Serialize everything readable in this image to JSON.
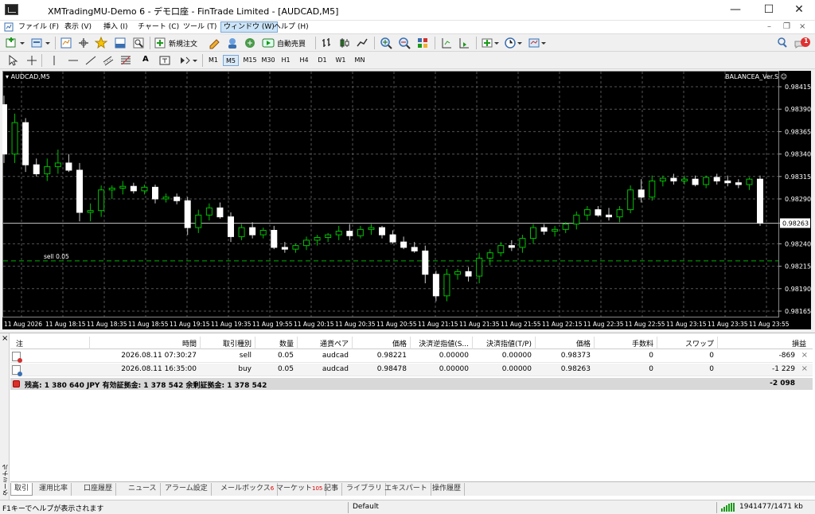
{
  "window": {
    "title": "XMTradingMU-Demo 6 - デモ口座 - FinTrade Limited - [AUDCAD,M5]"
  },
  "menu": [
    "ファイル (F)",
    "表示 (V)",
    "挿入 (I)",
    "チャート (C)",
    "ツール (T)",
    "ウィンドウ (W)",
    "ヘルプ (H)"
  ],
  "toolbar": {
    "new_order": "新規注文",
    "auto_trading": "自動売買"
  },
  "timeframes": [
    "M1",
    "M5",
    "M15",
    "M30",
    "H1",
    "H4",
    "D1",
    "W1",
    "MN"
  ],
  "selected_timeframe": "M5",
  "chart": {
    "symbol": "AUDCAD,M5",
    "indicator": "BALANCEA_Ver.S ☺",
    "current_price": "0.98263",
    "order_line_label": "sell 0.05"
  },
  "chart_data": {
    "type": "candlestick",
    "symbol": "AUDCAD,M5",
    "y_ticks": [
      "0.98415",
      "0.98390",
      "0.98365",
      "0.98340",
      "0.98315",
      "0.98290",
      "0.98263",
      "0.98240",
      "0.98215",
      "0.98190",
      "0.98165"
    ],
    "x_ticks": [
      "11 Aug 2026",
      "11 Aug 18:15",
      "11 Aug 18:35",
      "11 Aug 18:55",
      "11 Aug 19:15",
      "11 Aug 19:35",
      "11 Aug 19:55",
      "11 Aug 20:15",
      "11 Aug 20:35",
      "11 Aug 20:55",
      "11 Aug 21:15",
      "11 Aug 21:35",
      "11 Aug 21:55",
      "11 Aug 22:15",
      "11 Aug 22:35",
      "11 Aug 22:55",
      "11 Aug 23:15",
      "11 Aug 23:35",
      "11 Aug 23:55"
    ],
    "ylim": [
      0.98155,
      0.98425
    ],
    "ohlc": [
      [
        0.98395,
        0.98405,
        0.9833,
        0.9834
      ],
      [
        0.9834,
        0.98385,
        0.9833,
        0.98375
      ],
      [
        0.98375,
        0.9838,
        0.9832,
        0.98328
      ],
      [
        0.98328,
        0.98335,
        0.98315,
        0.98318
      ],
      [
        0.98318,
        0.98335,
        0.9831,
        0.98326
      ],
      [
        0.98326,
        0.98345,
        0.98318,
        0.9833
      ],
      [
        0.9833,
        0.9834,
        0.9832,
        0.98322
      ],
      [
        0.98322,
        0.9833,
        0.98265,
        0.98275
      ],
      [
        0.98275,
        0.98285,
        0.98265,
        0.98277
      ],
      [
        0.98277,
        0.98305,
        0.9827,
        0.983
      ],
      [
        0.983,
        0.98305,
        0.9829,
        0.98302
      ],
      [
        0.98302,
        0.9831,
        0.98295,
        0.98304
      ],
      [
        0.98304,
        0.98308,
        0.98296,
        0.98299
      ],
      [
        0.98299,
        0.98306,
        0.98295,
        0.98303
      ],
      [
        0.98303,
        0.98306,
        0.98285,
        0.9829
      ],
      [
        0.9829,
        0.98296,
        0.98286,
        0.98292
      ],
      [
        0.98292,
        0.98296,
        0.98284,
        0.98288
      ],
      [
        0.98288,
        0.98292,
        0.9825,
        0.98258
      ],
      [
        0.98258,
        0.98278,
        0.98252,
        0.98272
      ],
      [
        0.98272,
        0.98285,
        0.98266,
        0.9828
      ],
      [
        0.9828,
        0.98286,
        0.98268,
        0.9827
      ],
      [
        0.9827,
        0.98275,
        0.98242,
        0.98248
      ],
      [
        0.98248,
        0.98262,
        0.98244,
        0.98258
      ],
      [
        0.98258,
        0.98264,
        0.98246,
        0.9825
      ],
      [
        0.9825,
        0.98258,
        0.98246,
        0.98255
      ],
      [
        0.98255,
        0.9826,
        0.98234,
        0.98236
      ],
      [
        0.98236,
        0.98242,
        0.9823,
        0.98234
      ],
      [
        0.98234,
        0.9824,
        0.9823,
        0.98238
      ],
      [
        0.98238,
        0.98248,
        0.98233,
        0.98244
      ],
      [
        0.98244,
        0.9825,
        0.98238,
        0.98247
      ],
      [
        0.98247,
        0.98252,
        0.98242,
        0.9825
      ],
      [
        0.9825,
        0.9826,
        0.98244,
        0.98254
      ],
      [
        0.98254,
        0.98262,
        0.98244,
        0.98249
      ],
      [
        0.98249,
        0.9826,
        0.98246,
        0.98256
      ],
      [
        0.98256,
        0.98262,
        0.9825,
        0.98258
      ],
      [
        0.98258,
        0.9826,
        0.98246,
        0.9825
      ],
      [
        0.9825,
        0.98255,
        0.9824,
        0.98242
      ],
      [
        0.98242,
        0.98248,
        0.98234,
        0.98236
      ],
      [
        0.98236,
        0.98242,
        0.9823,
        0.98232
      ],
      [
        0.98232,
        0.98238,
        0.98196,
        0.98206
      ],
      [
        0.98206,
        0.9821,
        0.98176,
        0.98182
      ],
      [
        0.98182,
        0.98212,
        0.98176,
        0.98206
      ],
      [
        0.98206,
        0.98212,
        0.982,
        0.98209
      ],
      [
        0.98209,
        0.98214,
        0.98198,
        0.98204
      ],
      [
        0.98204,
        0.9823,
        0.98196,
        0.98224
      ],
      [
        0.98224,
        0.98234,
        0.98216,
        0.9823
      ],
      [
        0.9823,
        0.98242,
        0.98226,
        0.98238
      ],
      [
        0.98238,
        0.98244,
        0.98232,
        0.98236
      ],
      [
        0.98236,
        0.9825,
        0.9823,
        0.98246
      ],
      [
        0.98246,
        0.98262,
        0.9824,
        0.98258
      ],
      [
        0.98258,
        0.98262,
        0.9825,
        0.98254
      ],
      [
        0.98254,
        0.9826,
        0.98248,
        0.98256
      ],
      [
        0.98256,
        0.98264,
        0.98252,
        0.98262
      ],
      [
        0.98262,
        0.98276,
        0.98256,
        0.98272
      ],
      [
        0.98272,
        0.98282,
        0.98266,
        0.98278
      ],
      [
        0.98278,
        0.98282,
        0.9827,
        0.98272
      ],
      [
        0.98272,
        0.9828,
        0.98266,
        0.9827
      ],
      [
        0.9827,
        0.98282,
        0.98264,
        0.98278
      ],
      [
        0.98278,
        0.98305,
        0.98274,
        0.983
      ],
      [
        0.983,
        0.98312,
        0.98286,
        0.98292
      ],
      [
        0.98292,
        0.98316,
        0.98288,
        0.9831
      ],
      [
        0.9831,
        0.98316,
        0.98304,
        0.98313
      ],
      [
        0.98313,
        0.98318,
        0.98306,
        0.9831
      ],
      [
        0.9831,
        0.98316,
        0.98306,
        0.98312
      ],
      [
        0.98312,
        0.98316,
        0.98304,
        0.98306
      ],
      [
        0.98306,
        0.98316,
        0.98302,
        0.98314
      ],
      [
        0.98314,
        0.98318,
        0.98306,
        0.9831
      ],
      [
        0.9831,
        0.98316,
        0.98304,
        0.98308
      ],
      [
        0.98308,
        0.98312,
        0.98302,
        0.98306
      ],
      [
        0.98306,
        0.98314,
        0.983,
        0.98312
      ],
      [
        0.98312,
        0.98316,
        0.9826,
        0.98263
      ]
    ],
    "order_levels": [
      {
        "label": "sell 0.05",
        "price": 0.98221,
        "color": "#00b000"
      }
    ]
  },
  "terminal": {
    "label": "ターミナル",
    "columns": [
      "注",
      "時間",
      "取引種別",
      "数量",
      "通貨ペア",
      "価格",
      "決済逆指値(S...",
      "決済指値(T/P)",
      "価格",
      "手数料",
      "スワップ",
      "損益"
    ],
    "rows": [
      {
        "time": "2026.08.11 07:30:27",
        "type": "sell",
        "volume": "0.05",
        "symbol": "audcad",
        "price": "0.98221",
        "sl": "0.00000",
        "tp": "0.00000",
        "cur_price": "0.98373",
        "commission": "0",
        "swap": "0",
        "profit": "-869"
      },
      {
        "time": "2026.08.11 16:35:00",
        "type": "buy",
        "volume": "0.05",
        "symbol": "audcad",
        "price": "0.98478",
        "sl": "0.00000",
        "tp": "0.00000",
        "cur_price": "0.98263",
        "commission": "0",
        "swap": "0",
        "profit": "-1 229"
      }
    ],
    "balance_text": "残高: 1 380 640 JPY  有効証拠金: 1 378 542  余剰証拠金: 1 378 542",
    "total_profit": "-2 098",
    "tabs": [
      {
        "label": "取引",
        "badge": ""
      },
      {
        "label": "運用比率",
        "badge": ""
      },
      {
        "label": "口座履歴",
        "badge": ""
      },
      {
        "label": "ニュース",
        "badge": ""
      },
      {
        "label": "アラーム設定",
        "badge": ""
      },
      {
        "label": "メールボックス",
        "badge": "6"
      },
      {
        "label": "マーケット",
        "badge": "105"
      },
      {
        "label": "記事",
        "badge": ""
      },
      {
        "label": "ライブラリ",
        "badge": ""
      },
      {
        "label": "エキスパート",
        "badge": ""
      },
      {
        "label": "操作履歴",
        "badge": ""
      }
    ]
  },
  "status": {
    "help": "F1キーでヘルプが表示されます",
    "profile": "Default",
    "traffic": "1941477/1471 kb"
  },
  "notification_count": "1",
  "colors": {
    "bull": "#00c000",
    "bear": "#ffffff",
    "order_line": "#00b000",
    "grid": "#646464"
  }
}
